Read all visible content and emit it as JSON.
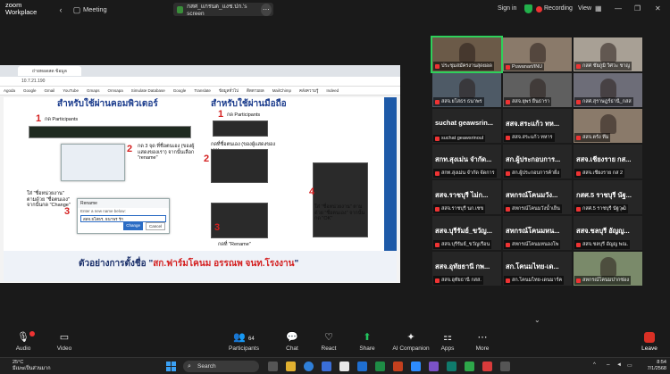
{
  "topbar": {
    "brand_line1": "zoom",
    "brand_line2": "Workplace",
    "meeting_label": "Meeting",
    "share_text": "กสศ_แกรนด_แงช.ปก.'s screen",
    "signin_label": "Sign in",
    "recording_label": "Recording",
    "view_label": "View"
  },
  "browser": {
    "tab_title": "ถ่ายทอดสด ข้อมูล",
    "address": "10.7.21.190",
    "copilot_label": "Copilot",
    "bookmarks": [
      "Agoda",
      "Google",
      "Gmail",
      "YouTube",
      "Gmaps",
      "Ornsapa",
      "Simulate Database",
      "Google",
      "Translate",
      "ข้อมูลทั่วไป",
      "ติดตามผล",
      "MailChimp",
      "คลังความรู้",
      "Indeed"
    ]
  },
  "slide": {
    "left_heading": "สำหรับใช้ผ่านคอมพิวเตอร์",
    "right_heading": "สำหรับใช้ผ่านมือถือ",
    "step1_left": "กด Participants",
    "step2_left": "กด 3 จุด ที่ชื่อตนเอง (ของผู้แสดงของเรา) จากนั้นเลือก \"rename\"",
    "step3_left": "ใส่ \"ชื่อหน่วยงาน\" ตามด้วย \"ชื่อตนเอง\" จากนั้นกด \"Change\"",
    "step1_right": "กด Participants",
    "step2_right": "กดที่ชื่อตนเอง (ของผู้แสดงของเรา)",
    "step3_right": "กดที่ \"Rename\"",
    "step4_right": "ใส่ \"ชื่อหน่วยงาน\" ตามด้วย \"ชื่อตนเอง\" จากนั้นกด \"OK\"",
    "dialog_title": "Rename",
    "dialog_hint": "Enter a new name below:",
    "dialog_value": "สสจ.ยโสธร, ธนาพร รัก",
    "dialog_change": "Change",
    "dialog_cancel": "Cancel",
    "footer_prefix": "ตัวอย่างการตั้งชื่อ \"",
    "footer_red": "สก.ฟาร์มโคนม อรรณพ จนท.โรงงาน",
    "footer_suffix": "\""
  },
  "gallery": {
    "tiles": [
      {
        "kind": "video",
        "name": "ประชุมสมัครงานสุดยอด"
      },
      {
        "kind": "video",
        "name": "Puwanart/INU"
      },
      {
        "kind": "video",
        "name": "กสศ ชัยภูมิ วิศวะ ชาญ"
      },
      {
        "kind": "video",
        "name": "สสจ.ยโสธร ธนาพร"
      },
      {
        "kind": "video",
        "name": "สสจ.ยุพร ยืนธารา"
      },
      {
        "kind": "video",
        "name": "กสศ.สุราษฎร์ธานี_กสส"
      },
      {
        "kind": "text",
        "big": "suchat geawsrin...",
        "name": "suchat geawsrinoul"
      },
      {
        "kind": "text",
        "big": "สสจ.สระแก้ว ทห...",
        "name": "สสจ.สระแก้ว ทหาร"
      },
      {
        "kind": "video",
        "name": "สสจ.ตรัง ทีม"
      },
      {
        "kind": "text",
        "big": "สกท.สุงเม่น จำกัด...",
        "name": "สกท.สุงเม่น จำกัด จัดการ"
      },
      {
        "kind": "text",
        "big": "สก.ผู้ประกอบการ...",
        "name": "สก.ผู้ประกอบการค้าฝั่ง"
      },
      {
        "kind": "text",
        "big": "สสจ.เชียงราย กส...",
        "name": "สสจ.เชียงราย กส 2"
      },
      {
        "kind": "text",
        "big": "สสจ.ราชบุรี ไม่ก...",
        "name": "สสจ.ราชบุรี นก.เชข"
      },
      {
        "kind": "text",
        "big": "สหกรณ์โคนมวัง...",
        "name": "สหกรณ์โคนมวังน้ำเย็น"
      },
      {
        "kind": "text",
        "big": "กสศ.5 ราชบุรี นัฐ...",
        "name": "กสศ.5 ราชบุรี นัฐวุฒิ"
      },
      {
        "kind": "text",
        "big": "สสจ.บุรีรัมย์_ขวัญ...",
        "name": "สสจ.บุรีรัมย์_ขวัญเรือน"
      },
      {
        "kind": "text",
        "big": "สหกรณ์โคนมหน...",
        "name": "สหกรณ์โคนมหนองโพ"
      },
      {
        "kind": "text",
        "big": "สสจ.ชลบุรี อัญญ...",
        "name": "สสจ.ชลบุรี อัญญ พณ."
      },
      {
        "kind": "text",
        "big": "สสจ.อุทัยธานี กพ...",
        "name": "สสจ.อุทัยธานี กสส."
      },
      {
        "kind": "text",
        "big": "สก.โคนมไทย-เด...",
        "name": "สก.โคนมไทย-เดนมาร์ค"
      },
      {
        "kind": "video",
        "name": "สหกรณ์โคนมปากช่อง"
      }
    ]
  },
  "toolbar": {
    "audio": "Audio",
    "video": "Video",
    "participants": "Participants",
    "participants_count": "64",
    "chat": "Chat",
    "react": "React",
    "share": "Share",
    "ai_companion": "AI Companion",
    "apps": "Apps",
    "more": "More",
    "leave": "Leave"
  },
  "taskbar": {
    "temp": "25°C",
    "weather_desc": "มีเมฆเป็นส่วนมาก",
    "search": "Search",
    "time": "8:54",
    "date": "7/1/2568"
  }
}
